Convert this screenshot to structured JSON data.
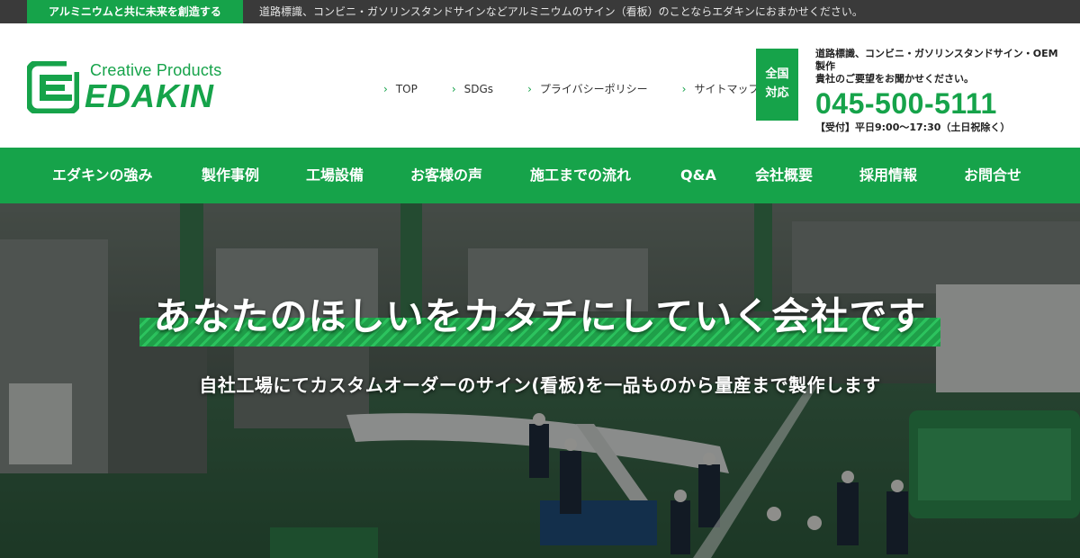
{
  "topbar": {
    "tagline": "アルミニウムと共に未来を創造する",
    "intro": "道路標識、コンビニ・ガソリンスタンドサインなどアルミニウムのサイン（看板）のことならエダキンにおまかせください。"
  },
  "logo": {
    "subtitle": "Creative Products",
    "name": "EDAKIN",
    "mark_icon": "edakin-e-logo-icon"
  },
  "topnav": [
    {
      "label": "TOP"
    },
    {
      "label": "SDGs"
    },
    {
      "label": "プライバシーポリシー"
    },
    {
      "label": "サイトマップ"
    }
  ],
  "contact": {
    "badge_line1": "全国",
    "badge_line2": "対応",
    "desc_line1": "道路標識、コンビニ・ガソリンスタンドサイン・OEM製作",
    "desc_line2": "貴社のご要望をお聞かせください。",
    "phone": "045-500-5111",
    "hours": "【受付】平日9:00～17:30（土日祝除く）"
  },
  "mainnav": [
    {
      "label": "エダキンの強み"
    },
    {
      "label": "製作事例"
    },
    {
      "label": "工場設備"
    },
    {
      "label": "お客様の声"
    },
    {
      "label": "施工までの流れ"
    },
    {
      "label": "Q&A"
    },
    {
      "label": "会社概要"
    },
    {
      "label": "採用情報"
    },
    {
      "label": "お問合せ"
    }
  ],
  "hero": {
    "headline": "あなたのほしいをカタチにしていく会社です",
    "subline": "自社工場にてカスタムオーダーのサイン(看板)を一品ものから量産まで製作します"
  },
  "colors": {
    "brand_green": "#16a34a",
    "topbar_dark": "#3a3a3a"
  }
}
